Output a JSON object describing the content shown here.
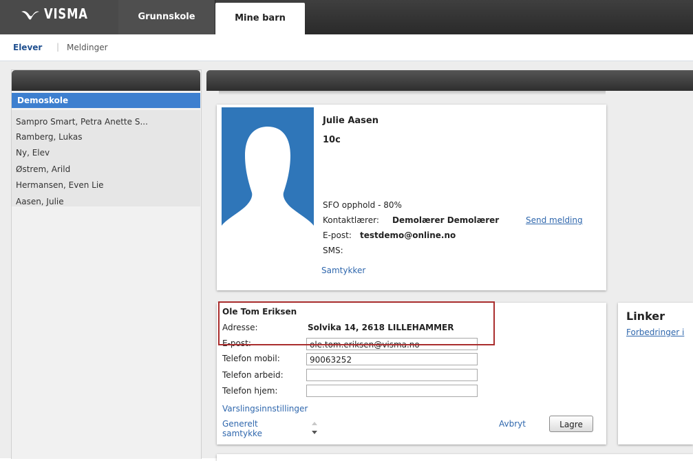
{
  "brand": {
    "logo_text": "VISMA"
  },
  "topnav": {
    "tabs": [
      {
        "label": "Grunnskole"
      },
      {
        "label": "Mine barn"
      }
    ]
  },
  "subnav": {
    "elever": "Elever",
    "separator": "|",
    "meldinger": "Meldinger"
  },
  "sidebar": {
    "school": "Demoskole",
    "students": [
      "Sampro Smart, Petra Anette S...",
      "Ramberg, Lukas",
      "Ny, Elev",
      "Østrem, Arild",
      "Hermansen, Even Lie",
      "Aasen, Julie"
    ]
  },
  "profile": {
    "name": "Julie Aasen",
    "class": "10c",
    "sfo": "SFO opphold - 80%",
    "contact_teacher_label": "Kontaktlærer:",
    "contact_teacher": "Demolærer Demolærer",
    "send_message": "Send melding",
    "email_label": "E-post:",
    "email": "testdemo@online.no",
    "sms_label": "SMS:",
    "consent_link": "Samtykker"
  },
  "guardian": {
    "name": "Ole Tom Eriksen",
    "address_label": "Adresse:",
    "address": "Solvika 14, 2618 LILLEHAMMER",
    "email_label": "E-post:",
    "email": "ole.tom.eriksen@visma.no",
    "mobile_label": "Telefon mobil:",
    "mobile": "90063252",
    "work_label": "Telefon arbeid:",
    "work": "",
    "home_label": "Telefon hjem:",
    "home": "",
    "notification_settings": "Varslingsinnstillinger",
    "general_consent": "Generelt samtykke",
    "cancel": "Avbryt",
    "save": "Lagre"
  },
  "links": {
    "title": "Linker",
    "first_link": "Forbedringer i"
  },
  "colors": {
    "accent": "#3d7fcf",
    "link": "#2f67ad",
    "highlight": "#a92c2c",
    "avatar": "#2f76b9"
  }
}
